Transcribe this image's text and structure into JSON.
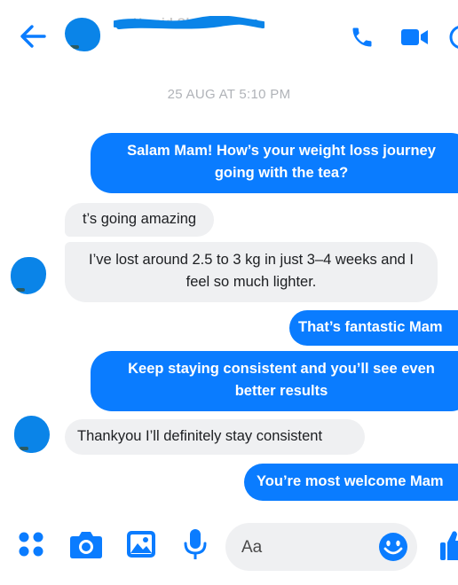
{
  "header": {
    "contact_name": "Hamid Shaikh"
  },
  "timestamp": "25 AUG AT 5:10 PM",
  "messages": [
    {
      "direction": "outgoing",
      "text": "Salam Mam! How’s your weight loss journey going with the tea?"
    },
    {
      "direction": "incoming",
      "text": "t’s going amazing"
    },
    {
      "direction": "incoming",
      "text": "I’ve lost around 2.5 to 3 kg in just 3–4 weeks and I feel so much lighter."
    },
    {
      "direction": "outgoing",
      "text": "That’s fantastic Mam"
    },
    {
      "direction": "outgoing",
      "text": "Keep staying consistent and you’ll see even better results"
    },
    {
      "direction": "incoming",
      "text": "Thankyou I’ll definitely stay consistent"
    },
    {
      "direction": "outgoing",
      "text": "You’re most welcome Mam"
    }
  ],
  "composer": {
    "placeholder": "Aa"
  },
  "colors": {
    "accent": "#0a7cff",
    "incoming_bubble": "#eff0f2",
    "timestamp_text": "#b0b3b8"
  },
  "icons": [
    "back-arrow-icon",
    "phone-icon",
    "video-icon",
    "info-icon",
    "menu-dots-icon",
    "camera-icon",
    "gallery-icon",
    "microphone-icon",
    "emoji-icon",
    "like-icon"
  ]
}
